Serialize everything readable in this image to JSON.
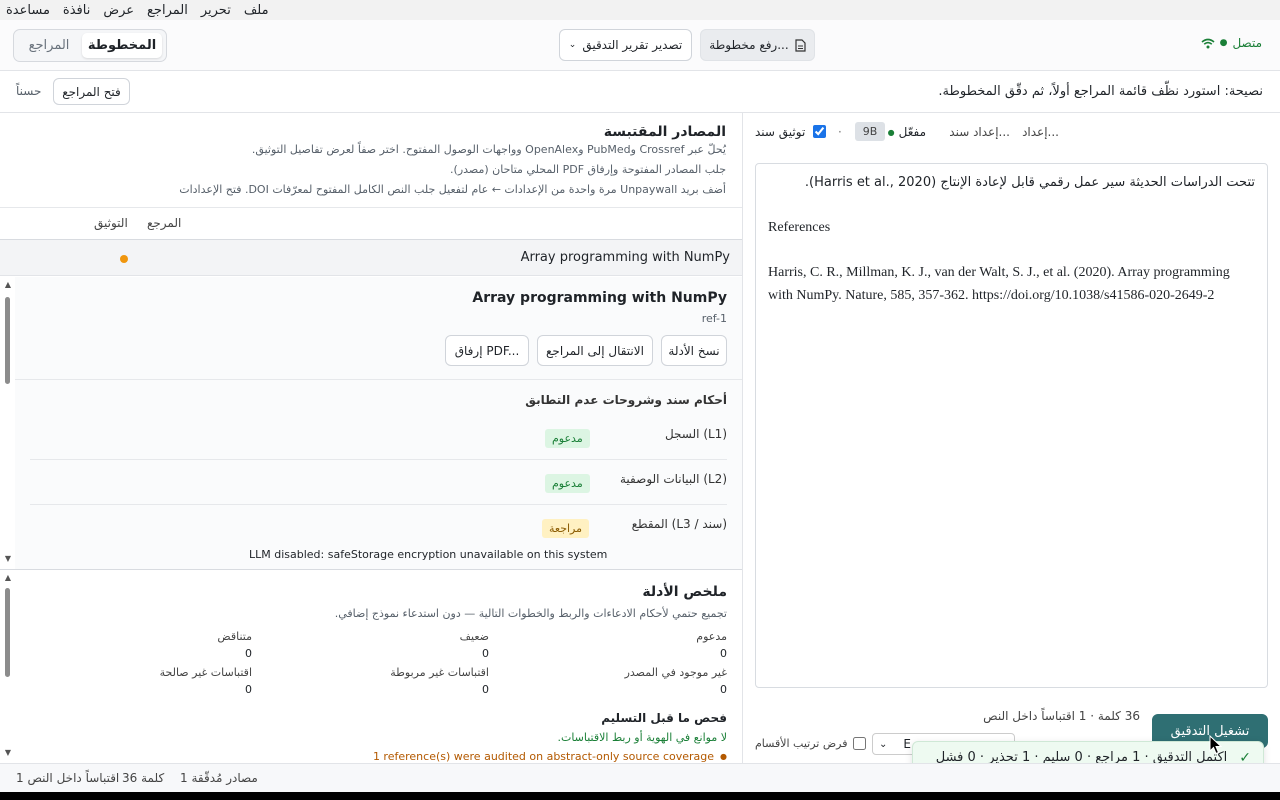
{
  "menu": [
    "ملف",
    "تحرير",
    "المراجع",
    "عرض",
    "نافذة",
    "مساعدة"
  ],
  "header": {
    "connection_status": "متصل",
    "upload_label": "رفع مخطوطة...",
    "export_label": "تصدير تقرير التدقيق",
    "tab_manuscript": "المخطوطة",
    "tab_references": "المراجع"
  },
  "tipbar": {
    "tip": "نصيحة: استورد نظّف قائمة المراجع أولاً، ثم دقّق المخطوطة.",
    "open_references": "فتح المراجع",
    "ok": "حسناً"
  },
  "right_toolbar": {
    "setup": "إعداد...",
    "setup_sanad": "إعداد سند...",
    "enabled": "مفعّل",
    "size_badge": "9B",
    "dot": "·",
    "verify_label": "توثيق سند",
    "verify_checked": true
  },
  "editor": {
    "para1": "تتحت الدراسات الحديثة سير عمل رقمي قابل لإعادة الإنتاج (Harris et al., 2020).",
    "heading": "References",
    "ref_line1": "Harris, C. R., Millman, K. J., van der Walt, S. J., et al. (2020). Array programming",
    "ref_line2": "with NumPy. Nature, 585, 357-362. https://doi.org/10.1038/s41586-020-2649-2"
  },
  "bottom_right": {
    "counts": "36 كلمة · 1 اقتباساً داخل النص",
    "run_audit": "تشغيل التدقيق",
    "enforce_order": "فرض ترتيب الأقسام",
    "select_value": "E"
  },
  "toast": {
    "message": "اكتمل التدقيق · 1 مراجع · 0 سليم · 1 تحذير · 0 فشل",
    "icon": "check-icon"
  },
  "sources": {
    "title": "المصادر المقتبسة",
    "desc1": "يُحلّ عبر Crossref وPubMed وOpenAlex وواجهات الوصول المفتوح. اختر صفاً لعرض تفاصيل التوثيق.",
    "desc2": "جلب المصادر المفتوحة وإرفاق PDF المحلي متاحان (مصدر).",
    "desc3": "أضف بريد Unpaywall مرة واحدة من الإعدادات ← عام لتفعيل جلب النص الكامل المفتوح لمعرّفات DOI. فتح الإعدادات",
    "col_reference": "المرجع",
    "col_verification": "التوثيق",
    "row_title": "Array programming with NumPy",
    "row_status_color": "#f0960e"
  },
  "detail": {
    "title": "Array programming with NumPy",
    "ref_id": "ref-1",
    "copy_evidence": "نسخ الأدلة",
    "go_references": "الانتقال إلى المراجع",
    "attach_pdf": "إرفاق PDF...",
    "verdicts_title": "أحكام سند وشروحات عدم التطابق",
    "verdicts": [
      {
        "label": "السجل (L1)",
        "status": "مدعوم",
        "kind": "green"
      },
      {
        "label": "البيانات الوصفية (L2)",
        "status": "مدعوم",
        "kind": "green"
      },
      {
        "label": "المقطع (L3 / سند)",
        "status": "مراجعة",
        "kind": "yellow"
      }
    ],
    "llm_note": "LLM disabled: safeStorage encryption unavailable on this system"
  },
  "summary": {
    "title": "ملخص الأدلة",
    "desc": "تجميع حتمي لأحكام الادعاءات والربط والخطوات التالية — دون استدعاء نموذج إضافي.",
    "stats": [
      {
        "label": "مدعوم",
        "value": "0"
      },
      {
        "label": "ضعيف",
        "value": "0"
      },
      {
        "label": "متناقض",
        "value": "0"
      },
      {
        "label": "غير موجود في المصدر",
        "value": "0"
      },
      {
        "label": "اقتباسات غير مربوطة",
        "value": "0"
      },
      {
        "label": "اقتباسات غير صالحة",
        "value": "0"
      }
    ],
    "precheck_title": "فحص ما قبل التسليم",
    "precheck_ok": "لا موانع في الهوية أو ربط الاقتباسات.",
    "precheck_warn": "1 reference(s) were audited on abstract-only source coverage"
  },
  "footer": {
    "sources_count": "1 مصادر مُدقّقة",
    "words": "36 كلمة",
    "citations": "1 اقتباساً داخل النص"
  },
  "colors": {
    "accent_green": "#1a7f37",
    "run_button": "#2f6f73",
    "warning_orange": "#f0960e"
  }
}
